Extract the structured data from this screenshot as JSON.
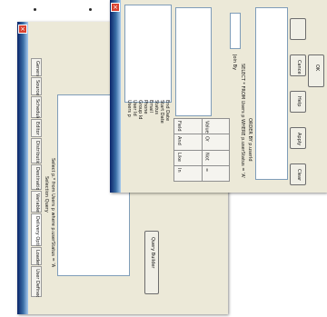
{
  "back_window": {
    "tabs": [
      "General",
      "Source",
      "Schedule",
      "Editor",
      "Distribution",
      "Destination",
      "Variables",
      "Delivery Options",
      "Loader",
      "User Defined"
    ],
    "section_label": "Selection Query",
    "query_text": "Select p.* from Users p where p.userStatus = 'A'",
    "button_label": "Query Builder"
  },
  "front_window": {
    "left_list": [
      "Users p",
      "User Id",
      "Group Id",
      "Phone",
      "Email",
      "Status",
      "Start Date",
      "End Date"
    ],
    "grid_cells": [
      "Field",
      "Value",
      "And",
      "Or",
      "Like",
      "Not",
      "In",
      "="
    ],
    "field_label": "Join By",
    "query_lines": [
      "SELECT * FROM Users p WHERE p.userStatus = 'A'",
      "ORDER BY p.userId"
    ],
    "buttons": [
      "Clear",
      "Apply",
      "Help",
      "Cancel",
      "OK"
    ]
  }
}
